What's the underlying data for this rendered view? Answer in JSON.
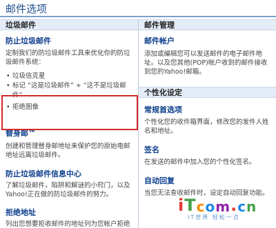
{
  "page_title": "邮件选项",
  "left": {
    "header": "垃圾邮件",
    "spam_protection": {
      "title": "防止垃圾邮件",
      "desc": "定制我们的防垃圾邮件工具来优化你的防垃圾邮件系统：",
      "bullets": [
        "垃圾信克星",
        "标记 “这是垃圾邮件” + “这不是垃圾邮件”",
        "拒绝图像"
      ]
    },
    "alias": {
      "title": "替身邮™",
      "desc": "创建和管理替身邮地址来保护您的原始电邮地址远离垃圾邮件。"
    },
    "spam_info": {
      "title": "防止垃圾邮件信息中心",
      "desc": "了解垃圾邮件，陷阱和解谜的小窍门，以及Yahoo!正在做的防垃圾邮件的努力。"
    },
    "blocked": {
      "title": "拒绝地址",
      "desc": "列出您想要拒收邮件的地址列为您帐户拒绝的地址，拒收来自拒绝地址的邮件。"
    }
  },
  "right": {
    "header": "邮件管理",
    "accounts": {
      "title": "邮件帐户",
      "desc": "添加或编辑您可以发送邮件的电子邮件地址。以及您其他(POP)帐户收到的邮件接收到您的Yahoo!邮箱。"
    },
    "personalization_header": "个性化设定",
    "general": {
      "title": "常规首选项",
      "desc": "个性化您的收件箱界面，修改您的发件人姓名和地址。"
    },
    "signature": {
      "title": "签名",
      "desc": "在发送的邮件中加入您的个性化签名。"
    },
    "auto_reply": {
      "title": "自动回复",
      "desc": "当您无法查收邮件时，设定自动回复功能。"
    }
  },
  "watermark": {
    "letters": [
      "i",
      "T",
      "c",
      "o",
      "m",
      ".",
      "c",
      "n"
    ],
    "colors": [
      "#e53935",
      "#43a047",
      "#fb8c00",
      "#1e88e5",
      "#8e24aa",
      "#e53935",
      "#1e88e5",
      "#43a047"
    ],
    "sub": "IT世界  轻松一点"
  },
  "colors": {
    "link": "#0c3e8c",
    "header_bg": "#e4ecf7",
    "highlight_border": "#d62828"
  }
}
